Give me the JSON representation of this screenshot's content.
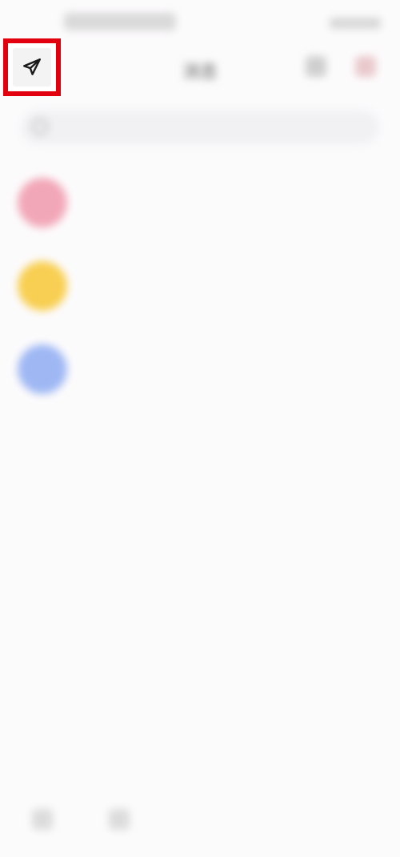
{
  "statusbar": {
    "time": "",
    "battery": ""
  },
  "header": {
    "title": "消息"
  },
  "search": {
    "placeholder": ""
  },
  "messages": [
    {
      "title": "",
      "subtitle": "",
      "time": "",
      "color": "#f2a7b8"
    },
    {
      "title": "",
      "subtitle": "",
      "time": "",
      "color": "#f8cf52"
    },
    {
      "title": "",
      "subtitle": "",
      "time": "",
      "color": "#9fb8f4"
    }
  ],
  "bottom_nav": [
    {
      "label": ""
    },
    {
      "label": ""
    }
  ],
  "icons": {
    "send": "paper-plane-icon",
    "search": "search-icon"
  },
  "colors": {
    "highlight": "#e3000e"
  }
}
